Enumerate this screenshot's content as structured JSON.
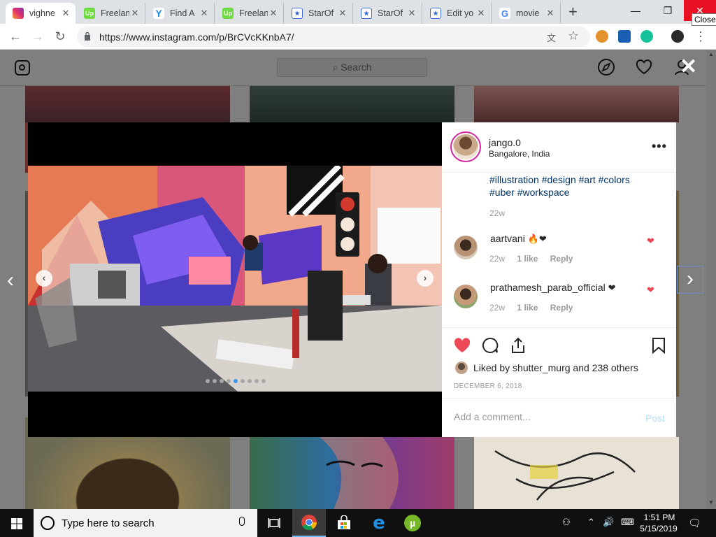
{
  "browser": {
    "tabs": [
      {
        "title": "vighne",
        "favicon": "instagram-icon",
        "active": true
      },
      {
        "title": "Freelan",
        "favicon": "upwork-icon"
      },
      {
        "title": "Find A",
        "favicon": "yoast-icon"
      },
      {
        "title": "Freelan",
        "favicon": "upwork-icon"
      },
      {
        "title": "StarOf",
        "favicon": "starofservice-icon"
      },
      {
        "title": "StarOf",
        "favicon": "starofservice-icon"
      },
      {
        "title": "Edit yo",
        "favicon": "starofservice-icon"
      },
      {
        "title": "movie",
        "favicon": "google-icon"
      }
    ],
    "new_tab": "+",
    "window_controls": {
      "minimize": "—",
      "restore": "❐",
      "close": "✕"
    },
    "close_tooltip": "Close",
    "url": "https://www.instagram.com/p/BrCVcKKnbA7/"
  },
  "instagram": {
    "search_placeholder": "Search",
    "modal_close": "✕",
    "post": {
      "author": "jango.0",
      "location": "Bangalore, India",
      "more": "•••",
      "caption_tags_line1": "#illustration #design #art #colors",
      "caption_tags_line2": "#uber #workspace",
      "caption_time": "22w",
      "carousel": {
        "count": 9,
        "active_index": 4,
        "prev": "‹",
        "next": "›"
      },
      "comments": [
        {
          "user": "aartvani",
          "emoji": "🔥❤",
          "time": "22w",
          "likes": "1 like",
          "reply": "Reply"
        },
        {
          "user": "prathamesh_parab_official",
          "emoji": "❤",
          "time": "22w",
          "likes": "1 like",
          "reply": "Reply"
        }
      ],
      "likes_prefix": "Liked by",
      "likes_user": "shutter_murg",
      "likes_and": "and",
      "likes_others": "238 others",
      "date": "DECEMBER 6, 2018",
      "comment_placeholder": "Add a comment...",
      "post_button": "Post"
    },
    "prev_post": "‹",
    "next_post": "›"
  },
  "taskbar": {
    "search_label": "Type here to search",
    "time": "1:51 PM",
    "date": "5/15/2019"
  },
  "colors": {
    "like_red": "#ed4956",
    "link_blue": "#003569",
    "post_button_disabled": "#b2dffc",
    "active_dot": "#3897f0"
  }
}
